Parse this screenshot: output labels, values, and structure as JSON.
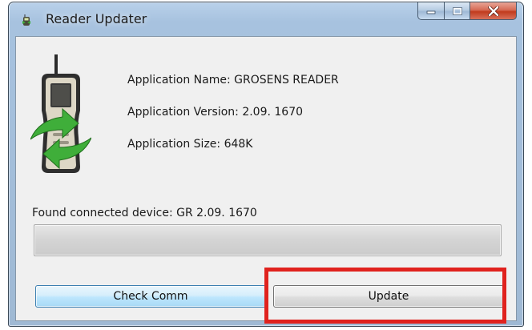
{
  "window": {
    "title": "Reader Updater",
    "icon": "reader-device-icon"
  },
  "caption_buttons": {
    "minimize_icon": "minimize-icon",
    "maximize_icon": "maximize-icon",
    "close_icon": "close-icon",
    "close_color": "#c13b1e"
  },
  "app_info": {
    "name_line": "Application Name: GROSENS READER",
    "version_line": "Application Version: 2.09. 1670",
    "size_line": "Application Size: 648K",
    "graphic": "handheld-reader-with-green-sync-arrows"
  },
  "status": {
    "found_device": "Found connected device: GR 2.09. 1670"
  },
  "progress": {
    "fraction": 0
  },
  "buttons": {
    "check_comm": "Check Comm",
    "update": "Update"
  },
  "colors": {
    "highlight": "#e0221e",
    "accent_blue": "#3c7fb1",
    "arrow_green": "#3fae3a"
  }
}
